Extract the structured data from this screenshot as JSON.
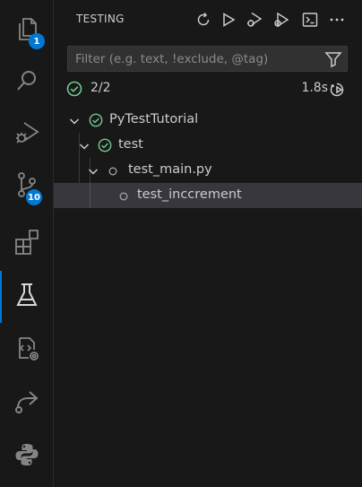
{
  "activity_bar": {
    "items": [
      {
        "name": "explorer",
        "icon": "files-icon",
        "badge": "1"
      },
      {
        "name": "search",
        "icon": "search-icon"
      },
      {
        "name": "run-debug",
        "icon": "run-debug-icon"
      },
      {
        "name": "source-control",
        "icon": "source-control-icon",
        "badge": "10"
      },
      {
        "name": "extensions",
        "icon": "extensions-icon"
      },
      {
        "name": "testing",
        "icon": "beaker-icon",
        "active": true
      },
      {
        "name": "remote-explorer",
        "icon": "remote-explorer-icon"
      },
      {
        "name": "live-share",
        "icon": "live-share-icon"
      },
      {
        "name": "python",
        "icon": "python-icon"
      }
    ]
  },
  "header": {
    "title": "TESTING",
    "actions": [
      "refresh-icon",
      "run-all-icon",
      "debug-all-icon",
      "run-coverage-icon",
      "terminal-icon",
      "more-icon"
    ]
  },
  "filter": {
    "placeholder": "Filter (e.g. text, !exclude, @tag)",
    "value": ""
  },
  "summary": {
    "count": "2/2",
    "duration": "1.8s"
  },
  "tree": {
    "nodes": [
      {
        "label": "PyTestTutorial",
        "status": "passed",
        "expanded": true
      },
      {
        "label": "test",
        "status": "passed",
        "expanded": true
      },
      {
        "label": "test_main.py",
        "status": "unset",
        "expanded": true
      },
      {
        "label": "test_inccrement",
        "status": "unset",
        "selected": true
      }
    ]
  },
  "colors": {
    "accent": "#0078d4",
    "passed": "#73c991",
    "background": "#181818",
    "selection": "#37373d"
  }
}
